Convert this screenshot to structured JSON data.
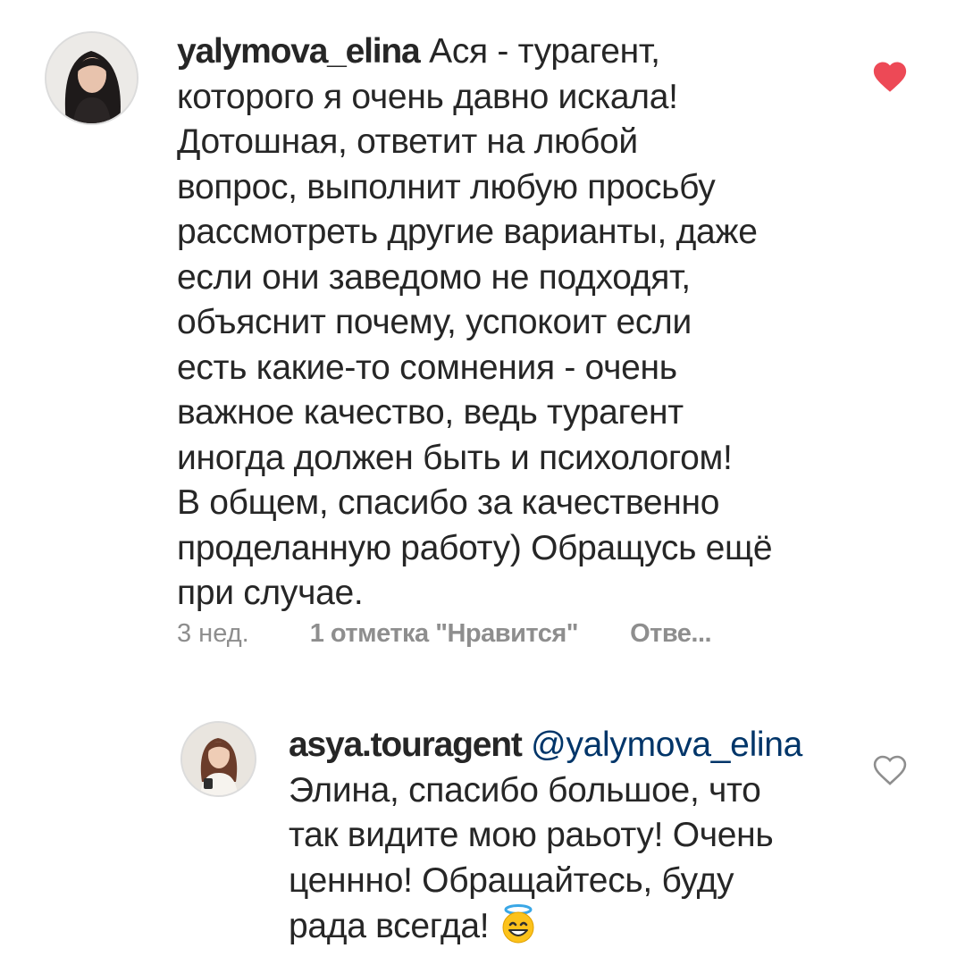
{
  "comment_1": {
    "username": "yalymova_elina",
    "text_lines": [
      "Ася - турагент,",
      "которого я очень давно искала!",
      "Дотошная, ответит на любой",
      "вопрос, выполнит любую просьбу",
      "рассмотреть другие варианты, даже",
      "если они заведомо не подходят,",
      "объяснит почему, успокоит если",
      "есть какие-то сомнения - очень",
      "важное качество, ведь турагент",
      "иногда должен быть и психологом!",
      "В общем, спасибо за качественно",
      "проделанную работу) Обращусь ещё",
      "при случае."
    ],
    "time": "3 нед.",
    "likes": "1 отметка \"Нравится\"",
    "reply": "Отве...",
    "liked": true,
    "heart_icon": "heart-filled-icon",
    "heart_color": "#ed4956"
  },
  "comment_2": {
    "username": "asya.touragent",
    "mention": "@yalymova_elina",
    "text_lines": [
      "Элина, спасибо большое, что",
      "так видите мою раьоту! Очень",
      "ценнно! Обращайтесь, буду",
      "рада всегда!"
    ],
    "emoji": "smiling-face-with-halo-icon",
    "liked": false,
    "heart_icon": "heart-outline-icon",
    "heart_color": "#8e8e8e"
  },
  "colors": {
    "text": "#262626",
    "meta": "#8e8e8e",
    "mention": "#003569",
    "background": "#ffffff"
  }
}
